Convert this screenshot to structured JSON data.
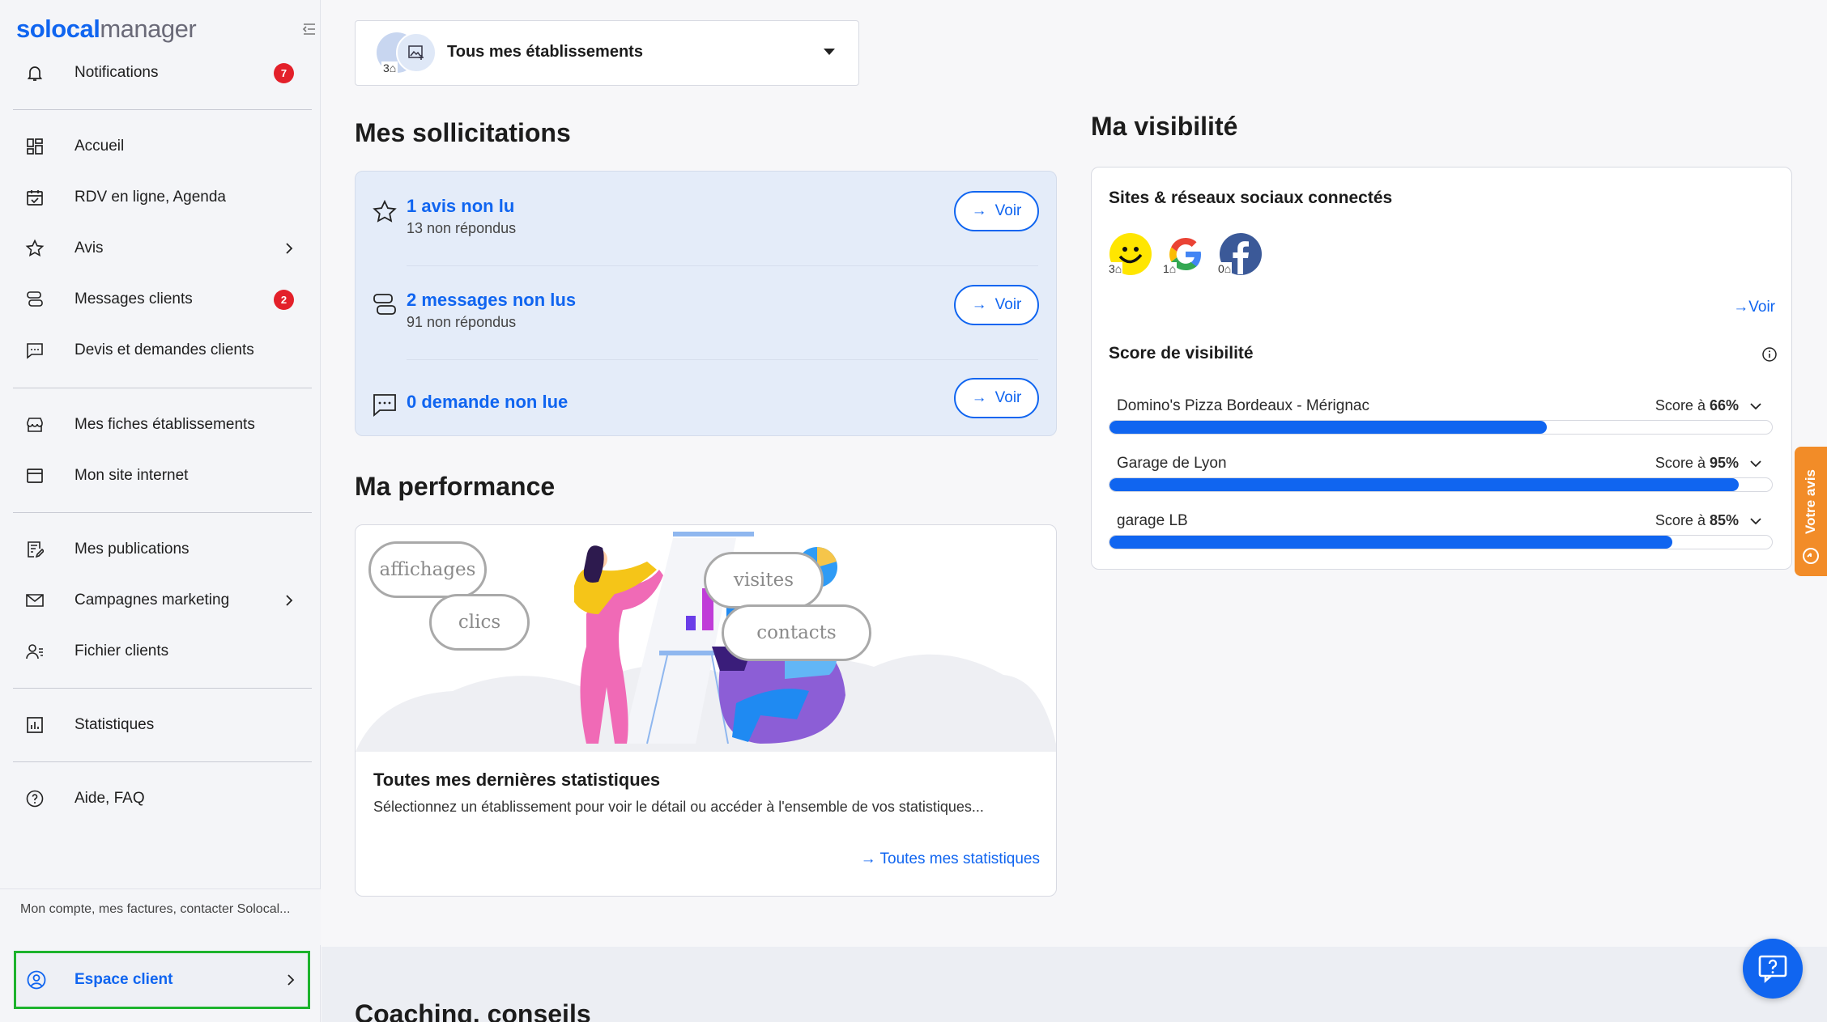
{
  "app": {
    "logo_bold": "solocal",
    "logo_light": "manager"
  },
  "sidebar": {
    "items": [
      {
        "label": "Notifications",
        "badge": "7"
      },
      {
        "label": "Accueil"
      },
      {
        "label": "RDV en ligne, Agenda"
      },
      {
        "label": "Avis"
      },
      {
        "label": "Messages clients",
        "badge": "2"
      },
      {
        "label": "Devis et demandes clients"
      },
      {
        "label": "Mes fiches établissements"
      },
      {
        "label": "Mon site internet"
      },
      {
        "label": "Mes publications"
      },
      {
        "label": "Campagnes marketing"
      },
      {
        "label": "Fichier clients"
      },
      {
        "label": "Statistiques"
      },
      {
        "label": "Aide, FAQ"
      }
    ],
    "account_note": "Mon compte, mes factures, contacter Solocal...",
    "espace_client": "Espace client"
  },
  "selector": {
    "label": "Tous mes établissements",
    "count": "3"
  },
  "sollicitations": {
    "title": "Mes sollicitations",
    "rows": [
      {
        "primary": "1 avis non lu",
        "secondary": "13 non répondus",
        "action": "Voir"
      },
      {
        "primary": "2 messages non lus",
        "secondary": "91 non répondus",
        "action": "Voir"
      },
      {
        "primary": "0 demande non lue",
        "secondary": "",
        "action": "Voir"
      }
    ]
  },
  "performance": {
    "title": "Ma performance",
    "bubbles": [
      "affichages",
      "clics",
      "visites",
      "contacts"
    ],
    "card_title": "Toutes mes dernières statistiques",
    "card_desc": "Sélectionnez un établissement pour voir le détail ou accéder à l'ensemble de vos statistiques...",
    "card_link": "Toutes mes statistiques"
  },
  "visibilite": {
    "title": "Ma visibilité",
    "social_title": "Sites & réseaux sociaux connectés",
    "networks": [
      {
        "name": "pagesjaunes-icon",
        "count": "3"
      },
      {
        "name": "google-icon",
        "count": "1"
      },
      {
        "name": "facebook-icon",
        "count": "0"
      }
    ],
    "voir": "Voir",
    "score_title": "Score de visibilité",
    "scores": [
      {
        "name": "Domino's Pizza Bordeaux - Mérignac",
        "prefix": "Score à ",
        "value": "66%",
        "fraction": 0.66
      },
      {
        "name": "Garage de Lyon",
        "prefix": "Score à ",
        "value": "95%",
        "fraction": 0.95
      },
      {
        "name": "garage LB",
        "prefix": "Score à ",
        "value": "85%",
        "fraction": 0.85
      }
    ]
  },
  "coaching": {
    "title": "Coaching, conseils"
  },
  "feedback_tab": "Votre avis",
  "colors": {
    "brand_blue": "#1065f0",
    "badge_red": "#e3202a",
    "highlight_green": "#1db32d",
    "feedback_orange": "#f28c28"
  }
}
